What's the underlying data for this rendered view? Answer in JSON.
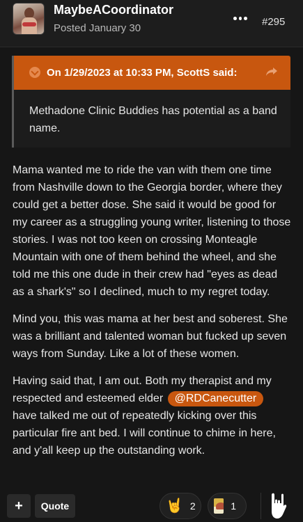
{
  "post": {
    "username": "MaybeACoordinator",
    "posted": "Posted January 30",
    "post_number": "#295",
    "more_icon": "ellipsis-icon",
    "avatar_icon": "user-avatar"
  },
  "quote": {
    "attribution": "On 1/29/2023 at 10:33 PM, ScottS said:",
    "text": "Methadone Clinic Buddies has potential as a band name.",
    "header_color": "#c8570f"
  },
  "body": {
    "p1": "Mama wanted me to ride the van with them one time from Nashville down to the Georgia border, where they could get a better dose. She said it would be good for my career as a struggling young writer, listening to those stories. I was not too keen on crossing Monteagle Mountain with one of them behind the wheel, and she told me this one dude in their crew had \"eyes as dead as a shark's\" so I declined, much to my regret today.",
    "p2": "Mind you, this was mama at her best and soberest. She was a brilliant and talented woman but fucked up seven ways from Sunday. Like a lot of these women.",
    "p3_before": "Having said that, I am out. Both my therapist and my respected and esteemed elder ",
    "p3_mention": "@RDCanecutter",
    "p3_after": " have talked me out of repeatedly kicking over this particular fire ant bed. I will continue to chime in here, and y'all keep up the outstanding work."
  },
  "footer": {
    "plus_label": "+",
    "quote_label": "Quote",
    "reactions": [
      {
        "icon": "rock-hand-emoji",
        "glyph": "🤘",
        "count": "2"
      },
      {
        "icon": "flag-badge-icon",
        "count": "1"
      }
    ],
    "react_icon": "rock-hand-icon"
  }
}
